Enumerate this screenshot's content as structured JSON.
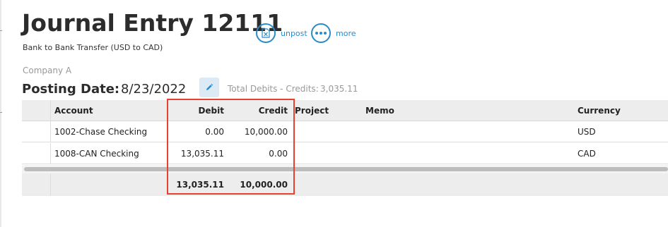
{
  "header": {
    "title": "Journal Entry 12111",
    "subtitle": "Bank to Bank Transfer (USD to CAD)"
  },
  "actions": {
    "unpost_label": "unpost",
    "more_label": "more",
    "unpost_icon": "document-x-icon",
    "more_icon": "ellipsis-icon",
    "accent_color": "#2a8bc7"
  },
  "company": "Company A",
  "posting": {
    "label": "Posting Date:",
    "date": "8/23/2022",
    "totals_label": "Total Debits - Credits:",
    "totals_value": "3,035.11"
  },
  "grid": {
    "columns": {
      "account": "Account",
      "debit": "Debit",
      "credit": "Credit",
      "project": "Project",
      "memo": "Memo",
      "currency": "Currency"
    },
    "rows": [
      {
        "account": "1002-Chase Checking",
        "debit": "0.00",
        "credit": "10,000.00",
        "project": "",
        "memo": "",
        "currency": "USD"
      },
      {
        "account": "1008-CAN Checking",
        "debit": "13,035.11",
        "credit": "0.00",
        "project": "",
        "memo": "",
        "currency": "CAD"
      }
    ],
    "footer": {
      "debit_total": "13,035.11",
      "credit_total": "10,000.00"
    }
  },
  "annotation": {
    "highlight_color": "#e8402f"
  }
}
